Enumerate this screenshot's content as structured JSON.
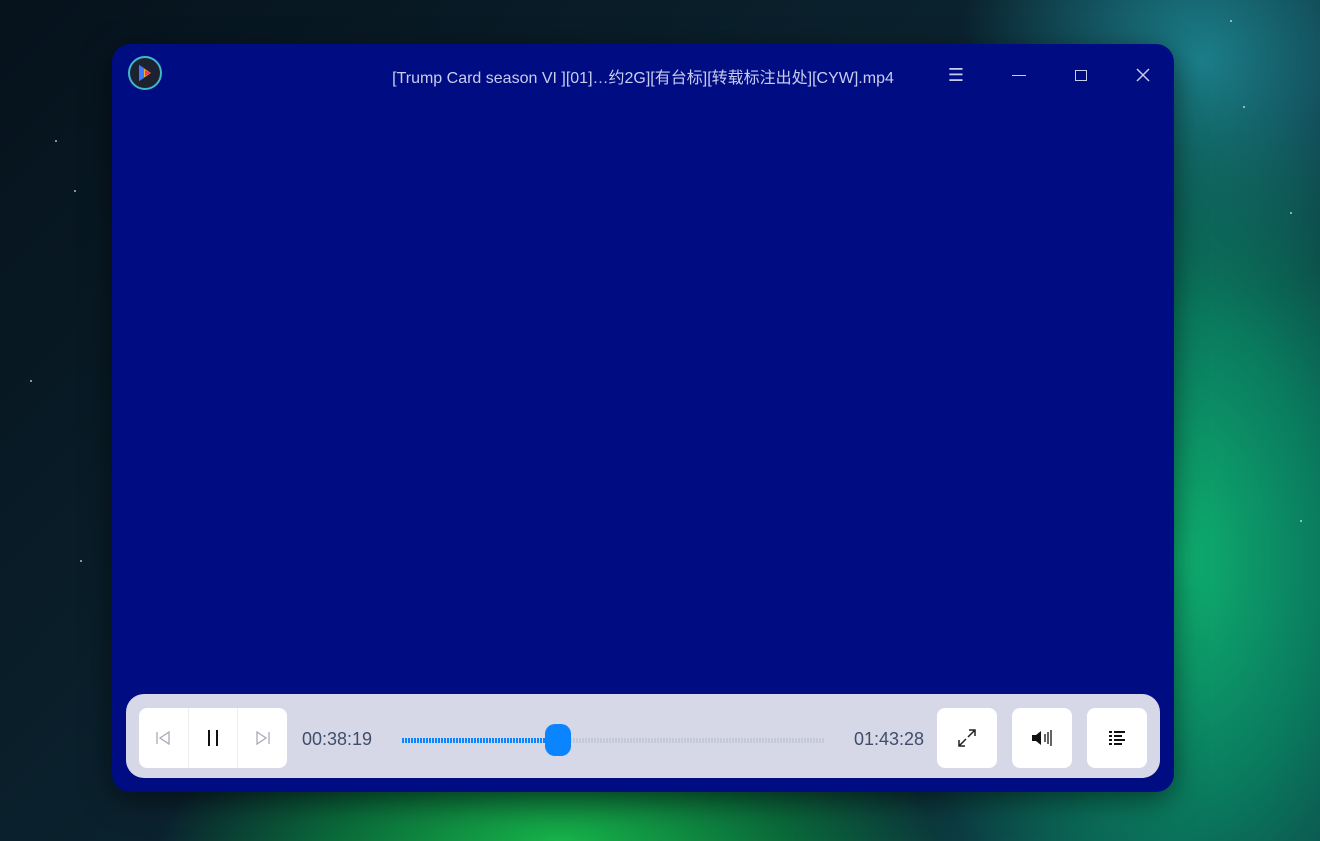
{
  "window": {
    "title": "[Trump Card season VI ][01]…约2G][有台标][转载标注出处][CYW].mp4",
    "video_bg": "#000c82"
  },
  "controls": {
    "current_time": "00:38:19",
    "total_time": "01:43:28",
    "progress": 0.37,
    "accent": "#0a84ff"
  },
  "icons": [
    "app-logo-icon",
    "menu-icon",
    "minimize-icon",
    "maximize-icon",
    "close-icon",
    "previous-icon",
    "pause-icon",
    "next-icon",
    "fullscreen-icon",
    "volume-icon",
    "playlist-icon"
  ]
}
